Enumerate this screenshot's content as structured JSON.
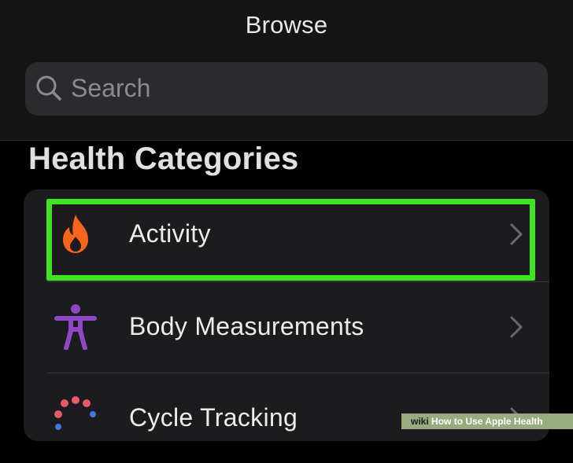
{
  "header": {
    "title": "Browse"
  },
  "search": {
    "placeholder": "Search",
    "value": "",
    "icon": "magnifying-glass"
  },
  "section": {
    "title": "Health Categories"
  },
  "categories": [
    {
      "label": "Activity",
      "icon": "flame",
      "color": "#f5651c",
      "highlighted": true
    },
    {
      "label": "Body Measurements",
      "icon": "person-figure",
      "color": "#8e47c9",
      "highlighted": false
    },
    {
      "label": "Cycle Tracking",
      "icon": "cycle-dots",
      "color": "#e85a6b",
      "highlighted": false
    }
  ],
  "highlight": {
    "color": "#3fe31f"
  },
  "watermark": {
    "brand": "wiki",
    "text": "How to Use Apple Health"
  }
}
